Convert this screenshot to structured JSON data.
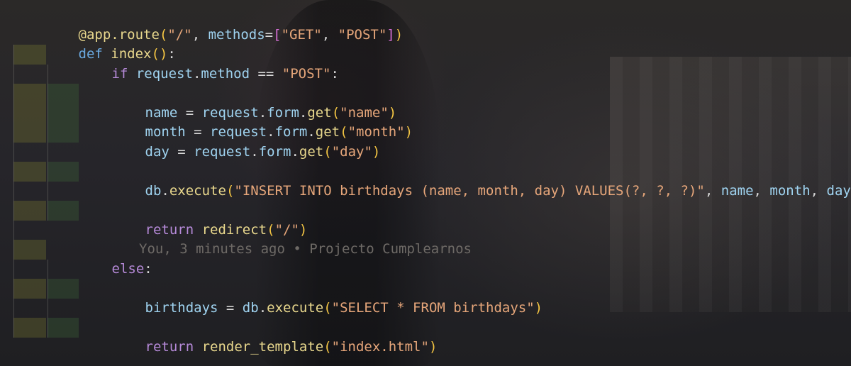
{
  "editor": {
    "language": "python",
    "colors": {
      "keyword": "#b68ad9",
      "def_keyword": "#6aa9e0",
      "function": "#e9d88d",
      "variable": "#9fd3f0",
      "string": "#e6a67a",
      "bracket_level_1": "#f4c543",
      "bracket_level_2": "#d66fd6",
      "blame": "#6e6a66"
    },
    "lines": [
      {
        "tokens": [
          "@app.route",
          "(",
          "\"/\"",
          ", ",
          "methods",
          "=",
          "[",
          "\"GET\"",
          ", ",
          "\"POST\"",
          "]",
          ")"
        ]
      },
      {
        "tokens": [
          "def",
          " ",
          "index",
          "(",
          ")",
          ":"
        ]
      },
      {
        "tokens": [
          "if",
          " ",
          "request",
          ".",
          "method",
          " == ",
          "\"POST\"",
          ":"
        ]
      },
      {
        "tokens": []
      },
      {
        "tokens": [
          "name",
          " = ",
          "request",
          ".",
          "form",
          ".",
          "get",
          "(",
          "\"name\"",
          ")"
        ]
      },
      {
        "tokens": [
          "month",
          " = ",
          "request",
          ".",
          "form",
          ".",
          "get",
          "(",
          "\"month\"",
          ")"
        ]
      },
      {
        "tokens": [
          "day",
          " = ",
          "request",
          ".",
          "form",
          ".",
          "get",
          "(",
          "\"day\"",
          ")"
        ]
      },
      {
        "tokens": []
      },
      {
        "tokens": [
          "db",
          ".",
          "execute",
          "(",
          "\"INSERT INTO birthdays (name, month, day) VALUES(?, ?, ?)\"",
          ", ",
          "name",
          ", ",
          "month",
          ", ",
          "day",
          ")"
        ]
      },
      {
        "tokens": []
      },
      {
        "tokens": [
          "return",
          " ",
          "redirect",
          "(",
          "\"/\"",
          ")"
        ]
      },
      {
        "tokens": []
      },
      {
        "tokens": [
          "else",
          ":"
        ],
        "blame": "You, 3 minutes ago • Projecto Cumplearnos"
      },
      {
        "tokens": []
      },
      {
        "tokens": [
          "birthdays",
          " = ",
          "db",
          ".",
          "execute",
          "(",
          "\"SELECT * FROM birthdays\"",
          ")"
        ]
      },
      {
        "tokens": []
      },
      {
        "tokens": [
          "return",
          " ",
          "render_template",
          "(",
          "\"index.html\"",
          ")"
        ]
      }
    ]
  }
}
